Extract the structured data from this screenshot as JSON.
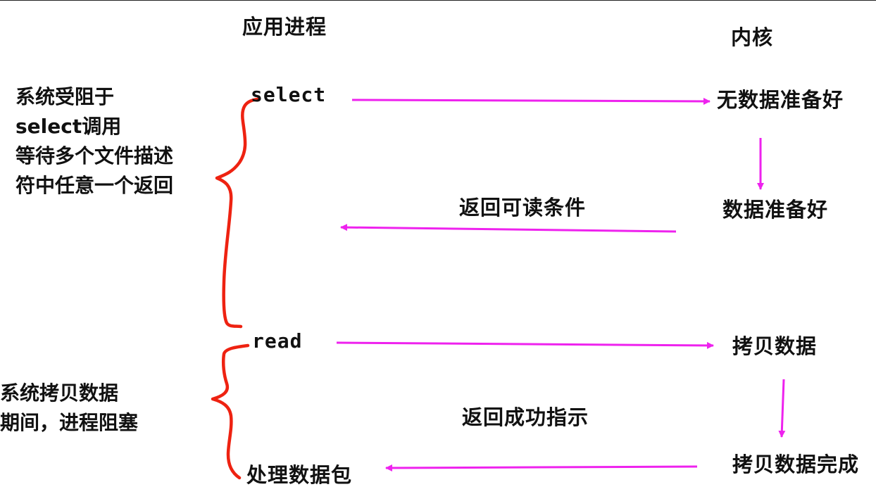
{
  "headers": {
    "app_process": "应用进程",
    "kernel": "内核"
  },
  "app_steps": {
    "select": "select",
    "read": "read",
    "process_packet": "处理数据包"
  },
  "kernel_states": {
    "no_data": "无数据准备好",
    "data_ready": "数据准备好",
    "copy_data": "拷贝数据",
    "copy_done": "拷贝数据完成"
  },
  "returns": {
    "readable": "返回可读条件",
    "success": "返回成功指示"
  },
  "notes": {
    "select_block": [
      "系统受阻于",
      "select调用",
      "等待多个文件描述",
      "符中任意一个返回"
    ],
    "copy_block": [
      "系统拷贝数据",
      "期间，进程阻塞"
    ]
  },
  "colors": {
    "arrow": "#ee22ee",
    "brace": "#ee2211"
  }
}
